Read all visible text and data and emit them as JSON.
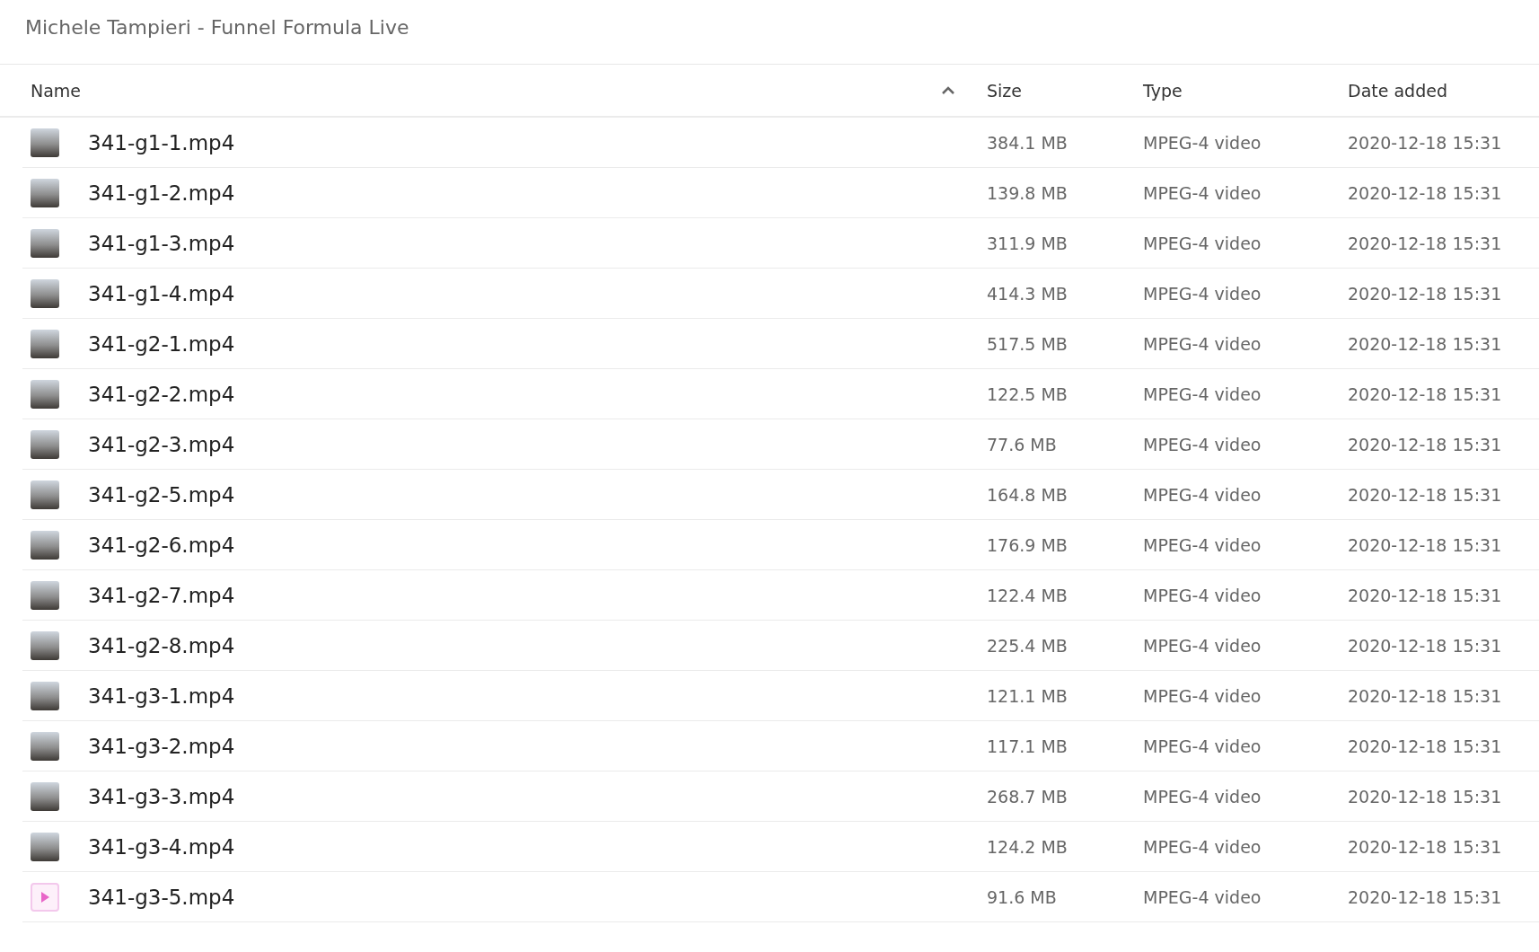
{
  "title": "Michele Tampieri - Funnel Formula Live",
  "columns": [
    {
      "label": "Name",
      "sorted": true
    },
    {
      "label": "Size",
      "sorted": false
    },
    {
      "label": "Type",
      "sorted": false
    },
    {
      "label": "Date added",
      "sorted": false
    }
  ],
  "rows": [
    {
      "kind": "thumbnail",
      "name": "341-g1-1.mp4",
      "size": "384.1 MB",
      "type": "MPEG-4 video",
      "date": "2020-12-18 15:31"
    },
    {
      "kind": "thumbnail",
      "name": "341-g1-2.mp4",
      "size": "139.8 MB",
      "type": "MPEG-4 video",
      "date": "2020-12-18 15:31"
    },
    {
      "kind": "thumbnail",
      "name": "341-g1-3.mp4",
      "size": "311.9 MB",
      "type": "MPEG-4 video",
      "date": "2020-12-18 15:31"
    },
    {
      "kind": "thumbnail",
      "name": "341-g1-4.mp4",
      "size": "414.3 MB",
      "type": "MPEG-4 video",
      "date": "2020-12-18 15:31"
    },
    {
      "kind": "thumbnail",
      "name": "341-g2-1.mp4",
      "size": "517.5 MB",
      "type": "MPEG-4 video",
      "date": "2020-12-18 15:31"
    },
    {
      "kind": "thumbnail",
      "name": "341-g2-2.mp4",
      "size": "122.5 MB",
      "type": "MPEG-4 video",
      "date": "2020-12-18 15:31"
    },
    {
      "kind": "thumbnail",
      "name": "341-g2-3.mp4",
      "size": "77.6 MB",
      "type": "MPEG-4 video",
      "date": "2020-12-18 15:31"
    },
    {
      "kind": "thumbnail",
      "name": "341-g2-5.mp4",
      "size": "164.8 MB",
      "type": "MPEG-4 video",
      "date": "2020-12-18 15:31"
    },
    {
      "kind": "thumbnail",
      "name": "341-g2-6.mp4",
      "size": "176.9 MB",
      "type": "MPEG-4 video",
      "date": "2020-12-18 15:31"
    },
    {
      "kind": "thumbnail",
      "name": "341-g2-7.mp4",
      "size": "122.4 MB",
      "type": "MPEG-4 video",
      "date": "2020-12-18 15:31"
    },
    {
      "kind": "thumbnail",
      "name": "341-g2-8.mp4",
      "size": "225.4 MB",
      "type": "MPEG-4 video",
      "date": "2020-12-18 15:31"
    },
    {
      "kind": "thumbnail",
      "name": "341-g3-1.mp4",
      "size": "121.1 MB",
      "type": "MPEG-4 video",
      "date": "2020-12-18 15:31"
    },
    {
      "kind": "thumbnail",
      "name": "341-g3-2.mp4",
      "size": "117.1 MB",
      "type": "MPEG-4 video",
      "date": "2020-12-18 15:31"
    },
    {
      "kind": "thumbnail",
      "name": "341-g3-3.mp4",
      "size": "268.7 MB",
      "type": "MPEG-4 video",
      "date": "2020-12-18 15:31"
    },
    {
      "kind": "thumbnail",
      "name": "341-g3-4.mp4",
      "size": "124.2 MB",
      "type": "MPEG-4 video",
      "date": "2020-12-18 15:31"
    },
    {
      "kind": "video-icon",
      "name": "341-g3-5.mp4",
      "size": "91.6 MB",
      "type": "MPEG-4 video",
      "date": "2020-12-18 15:31"
    }
  ]
}
